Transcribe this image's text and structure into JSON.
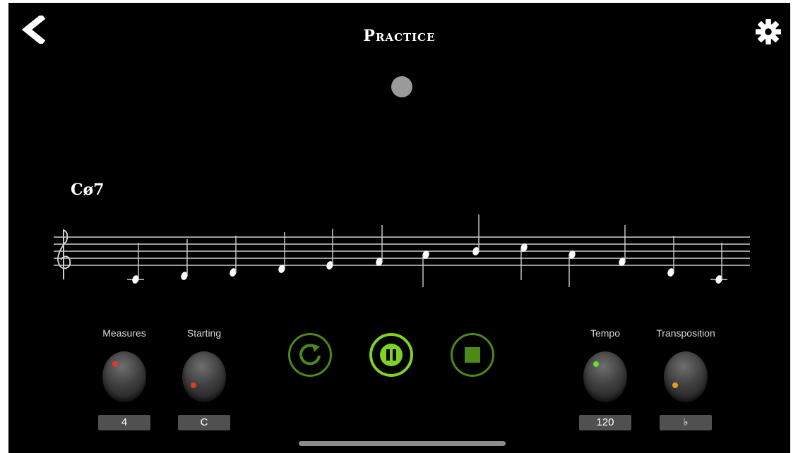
{
  "header": {
    "title": "Practice",
    "back_icon": "chevron-left-icon",
    "settings_icon": "gear-icon"
  },
  "chord": {
    "label": "Cø7"
  },
  "staff": {
    "clef": "treble-clef-icon",
    "note_count": 13
  },
  "controls": {
    "measures": {
      "label": "Measures",
      "value": "4",
      "dot_color": "#e23a2a"
    },
    "starting": {
      "label": "Starting",
      "value": "C",
      "dot_color": "#e23a2a"
    },
    "tempo": {
      "label": "Tempo",
      "value": "120",
      "dot_color": "#6bdc2a"
    },
    "transposition": {
      "label": "Transposition",
      "value": "♭",
      "dot_color": "#e89a1c"
    }
  },
  "transport": {
    "repeat_icon": "repeat-icon",
    "pause_icon": "pause-icon",
    "stop_icon": "stop-icon"
  },
  "colors": {
    "background": "#000000",
    "accent_green": "#7ed321",
    "dim_green": "#4c8a18",
    "beat_dot": "#9a9a9a"
  }
}
